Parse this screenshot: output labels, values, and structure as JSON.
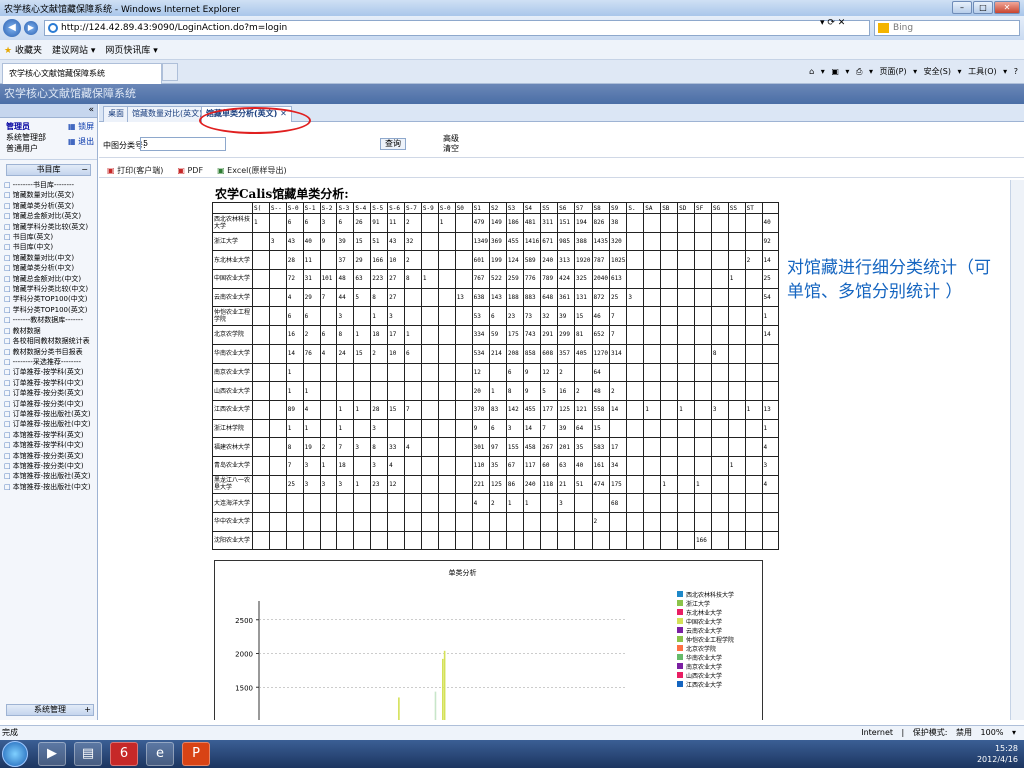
{
  "window": {
    "title": "农学核心文献馆藏保障系统 - Windows Internet Explorer"
  },
  "browser": {
    "url": "http://124.42.89.43:9090/LoginAction.do?m=login",
    "search_placeholder": "Bing",
    "fav_label": "收藏夹",
    "fav_items": [
      "建议网站 ▾",
      "网页快讯库 ▾"
    ],
    "tab_title": "农学核心文献馆藏保障系统",
    "cmd": "页面(P) ▾ 安全(S) ▾ 工具(O) ▾"
  },
  "app": {
    "header": "农学核心文献馆藏保障系统"
  },
  "user": {
    "role": "管理员",
    "dept": "系统管理部",
    "type": "普通用户",
    "btn_lock": "锁屏",
    "btn_logout": "退出"
  },
  "sidebar": {
    "section": "书目库",
    "items": [
      "--------书目库--------",
      "馆藏数量对比(英文)",
      "馆藏单类分析(英文)",
      "馆藏总金额对比(英文)",
      "馆藏学科分类比较(英文)",
      "书目库(英文)",
      "书目库(中文)",
      "馆藏数量对比(中文)",
      "馆藏单类分析(中文)",
      "馆藏总金额对比(中文)",
      "馆藏学科分类比较(中文)",
      "学科分类TOP100(中文)",
      "学科分类TOP100(英文)",
      "-------教材数据库-------",
      "教材数据",
      "各校相同教材数据统计表",
      "教材数据分类书目报表",
      "--------采选推荐--------",
      "订单推荐-按学科(英文)",
      "订单推荐-按学科(中文)",
      "订单推荐-按分类(英文)",
      "订单推荐-按分类(中文)",
      "订单推荐-按出版社(英文)",
      "订单推荐-按出版社(中文)",
      "本馆推荐-按学科(英文)",
      "本馆推荐-按学科(中文)",
      "本馆推荐-按分类(英文)",
      "本馆推荐-按分类(中文)",
      "本馆推荐-按出版社(英文)",
      "本馆推荐-按出版社(中文)"
    ],
    "system": "系统管理"
  },
  "page_tabs": [
    "桌面",
    "馆藏数量对比(英文)",
    "馆藏单类分析(英文)"
  ],
  "filter": {
    "label": "中图分类号:",
    "value": "5",
    "query": "查询",
    "advanced": "高级",
    "clear": "清空"
  },
  "export": {
    "print": "打印(客户端)",
    "pdf": "PDF",
    "excel": "Excel(原样导出)"
  },
  "report": {
    "title": "农学Calis馆藏单类分析:",
    "headers": [
      "S(",
      "S--",
      "S-0",
      "S-1",
      "S-2",
      "S-3",
      "S-4",
      "S-5",
      "S-6",
      "S-7",
      "S-9",
      "S-0",
      "S0",
      "S1",
      "S2",
      "S3",
      "S4",
      "S5",
      "S6",
      "S7",
      "S8",
      "S9",
      "S.",
      "SA",
      "SB",
      "SD",
      "SF",
      "SG",
      "SS",
      "ST",
      ""
    ],
    "rows": [
      {
        "name": "西北农林科技大学",
        "cells": {
          "0": "1",
          "2": "6",
          "3": "6",
          "4": "3",
          "5": "6",
          "6": "26",
          "7": "91",
          "8": "11",
          "9": "2",
          "11": "1",
          "13": "479",
          "14": "149",
          "15": "186",
          "16": "481",
          "17": "311",
          "18": "151",
          "19": "194",
          "20": "826",
          "21": "38",
          "30": "40"
        }
      },
      {
        "name": "浙江大学",
        "cells": {
          "1": "3",
          "2": "43",
          "3": "40",
          "4": "9",
          "5": "39",
          "6": "15",
          "7": "51",
          "8": "43",
          "9": "32",
          "13": "1349",
          "14": "369",
          "15": "455",
          "16": "1416",
          "17": "671",
          "18": "985",
          "19": "388",
          "20": "1435",
          "21": "320",
          "30": "92"
        }
      },
      {
        "name": "东北林业大学",
        "cells": {
          "2": "28",
          "3": "11",
          "5": "37",
          "6": "29",
          "7": "166",
          "8": "10",
          "9": "2",
          "13": "601",
          "14": "199",
          "15": "124",
          "16": "589",
          "17": "240",
          "18": "313",
          "19": "1920",
          "20": "787",
          "21": "1025",
          "29": "2",
          "30": "14"
        }
      },
      {
        "name": "中国农业大学",
        "cells": {
          "2": "72",
          "3": "31",
          "4": "101",
          "5": "48",
          "6": "63",
          "7": "223",
          "8": "27",
          "9": "8",
          "10": "1",
          "13": "767",
          "14": "522",
          "15": "259",
          "16": "776",
          "17": "789",
          "18": "424",
          "19": "325",
          "20": "2040",
          "21": "613",
          "28": "1",
          "30": "25"
        }
      },
      {
        "name": "云南农业大学",
        "cells": {
          "2": "4",
          "3": "29",
          "4": "7",
          "5": "44",
          "6": "5",
          "7": "8",
          "8": "27",
          "12": "13",
          "13": "638",
          "14": "143",
          "15": "188",
          "16": "883",
          "17": "648",
          "18": "361",
          "19": "131",
          "20": "872",
          "21": "25",
          "22": "3",
          "30": "54"
        }
      },
      {
        "name": "仲恺农业工程学院",
        "cells": {
          "2": "6",
          "3": "6",
          "5": "3",
          "7": "1",
          "8": "3",
          "13": "53",
          "14": "6",
          "15": "23",
          "16": "73",
          "17": "32",
          "18": "39",
          "19": "15",
          "20": "46",
          "21": "7",
          "30": "1"
        }
      },
      {
        "name": "北京农学院",
        "cells": {
          "2": "16",
          "3": "2",
          "4": "6",
          "5": "8",
          "6": "1",
          "7": "18",
          "8": "17",
          "9": "1",
          "13": "334",
          "14": "59",
          "15": "175",
          "16": "743",
          "17": "291",
          "18": "299",
          "19": "81",
          "20": "652",
          "21": "7",
          "30": "14"
        }
      },
      {
        "name": "华南农业大学",
        "cells": {
          "2": "14",
          "3": "76",
          "4": "4",
          "5": "24",
          "6": "15",
          "7": "2",
          "8": "10",
          "9": "6",
          "13": "534",
          "14": "214",
          "15": "208",
          "16": "858",
          "17": "608",
          "18": "357",
          "19": "405",
          "20": "1270",
          "21": "314",
          "27": "8"
        }
      },
      {
        "name": "南京农业大学",
        "cells": {
          "2": "1",
          "13": "12",
          "15": "6",
          "16": "9",
          "17": "12",
          "18": "2",
          "20": "64"
        }
      },
      {
        "name": "山西农业大学",
        "cells": {
          "2": "1",
          "3": "1",
          "13": "20",
          "14": "1",
          "15": "8",
          "16": "9",
          "17": "5",
          "18": "16",
          "19": "2",
          "20": "48",
          "21": "2"
        }
      },
      {
        "name": "江西农业大学",
        "cells": {
          "2": "89",
          "3": "4",
          "5": "1",
          "6": "1",
          "7": "28",
          "8": "15",
          "9": "7",
          "13": "370",
          "14": "83",
          "15": "142",
          "16": "455",
          "17": "177",
          "18": "125",
          "19": "121",
          "20": "558",
          "21": "14",
          "23": "1",
          "25": "1",
          "27": "3",
          "29": "1",
          "30": "13"
        }
      },
      {
        "name": "浙江林学院",
        "cells": {
          "2": "1",
          "3": "1",
          "5": "1",
          "7": "3",
          "13": "9",
          "14": "6",
          "15": "3",
          "16": "14",
          "17": "7",
          "18": "39",
          "19": "64",
          "20": "15",
          "30": "1"
        }
      },
      {
        "name": "福建农林大学",
        "cells": {
          "2": "8",
          "3": "19",
          "4": "2",
          "5": "7",
          "6": "3",
          "7": "8",
          "8": "33",
          "9": "4",
          "13": "301",
          "14": "97",
          "15": "155",
          "16": "458",
          "17": "267",
          "18": "201",
          "19": "35",
          "20": "583",
          "21": "17",
          "30": "4"
        }
      },
      {
        "name": "青岛农业大学",
        "cells": {
          "2": "7",
          "3": "3",
          "4": "1",
          "5": "18",
          "7": "3",
          "8": "4",
          "13": "110",
          "14": "35",
          "15": "67",
          "16": "117",
          "17": "60",
          "18": "63",
          "19": "40",
          "20": "161",
          "21": "34",
          "28": "1",
          "30": "3"
        }
      },
      {
        "name": "黑龙江八一农垦大学",
        "cells": {
          "2": "25",
          "3": "3",
          "4": "3",
          "5": "3",
          "6": "1",
          "7": "23",
          "8": "12",
          "13": "221",
          "14": "125",
          "15": "86",
          "16": "240",
          "17": "118",
          "18": "21",
          "19": "51",
          "20": "474",
          "21": "175",
          "24": "1",
          "26": "1",
          "30": "4"
        }
      },
      {
        "name": "大连海洋大学",
        "cells": {
          "13": "4",
          "14": "2",
          "15": "1",
          "16": "1",
          "18": "3",
          "21": "68"
        }
      },
      {
        "name": "华中农业大学",
        "cells": {
          "20": "2"
        }
      },
      {
        "name": "沈阳农业大学",
        "cells": {
          "26": "166"
        }
      }
    ]
  },
  "chart_data": {
    "type": "bar",
    "title": "单类分析",
    "ylim": [
      1000,
      2600
    ],
    "yticks": [
      1500,
      2000,
      2500
    ],
    "grid": true,
    "legend_position": "right",
    "legend": [
      "西北农林科技大学",
      "浙江大学",
      "东北林业大学",
      "中国农业大学",
      "云南农业大学",
      "仲恺农业工程学院",
      "北京农学院",
      "华南农业大学",
      "南京农业大学",
      "山西农业大学",
      "江西农业大学"
    ],
    "legend_colors": [
      "#1e88c8",
      "#8bc34a",
      "#e91e63",
      "#d4e157",
      "#7b1fa2",
      "#8bc34a",
      "#ff7043",
      "#66bb6a",
      "#7b1fa2",
      "#e91e63",
      "#1565c0"
    ],
    "visible_bars": [
      {
        "x": 0.38,
        "value": 1349,
        "color": "#d4e157"
      },
      {
        "x": 0.5,
        "value": 1920,
        "color": "#d4e157"
      },
      {
        "x": 0.505,
        "value": 2040,
        "color": "#d4e157"
      },
      {
        "x": 0.48,
        "value": 1435,
        "color": "#c8e6c9"
      }
    ]
  },
  "annotation": "对馆藏进行细分类统计（可单馆、多馆分别统计 ）",
  "status": {
    "left": "完成",
    "right": "Internet | 保护模式: 禁用   100% ▾"
  },
  "clock": {
    "time": "15:28",
    "date": "2012/4/16"
  }
}
